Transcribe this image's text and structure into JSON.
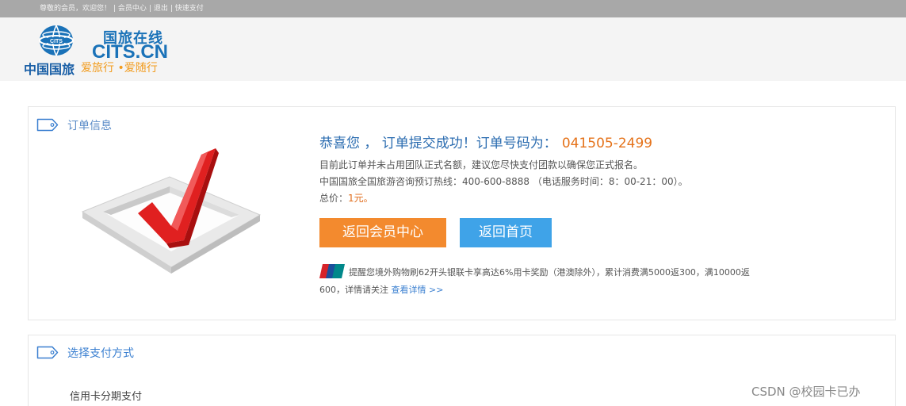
{
  "topbar": {
    "greeting": "尊敬的会员，欢迎您！",
    "links": [
      "会员中心",
      "退出",
      "快速支付"
    ]
  },
  "logo": {
    "brand_cn": "国旅在线",
    "brand_en": "CITS.CN",
    "company": "中国国旅",
    "slogan": "爱旅行 •爱随行"
  },
  "order_panel": {
    "title": "订单信息",
    "success_text": "恭喜您 ， 订单提交成功！订单号码为：",
    "order_number": "041505-2499",
    "line_1": "目前此订单并未占用团队正式名额，建议您尽快支付团款以确保您正式报名。",
    "line_2": "中国国旅全国旅游咨询预订热线：400-600-8888 （电话服务时间：8：00-21：00）。",
    "price_label": "总价：",
    "price_value": "1元。",
    "btn_member": "返回会员中心",
    "btn_home": "返回首页",
    "promo_line_1": "提醒您境外购物刷62开头银联卡享高达6%用卡奖励（港澳除外），累计消费满5000返300，满10000返",
    "promo_line_2": "600，详情请关注 ",
    "promo_link": "查看详情 >>"
  },
  "payment_panel": {
    "title": "选择支付方式",
    "option_1": "信用卡分期支付"
  },
  "watermark": "CSDN @校园卡已办",
  "colors": {
    "orange": "#f38a2e",
    "blue": "#3fa3e8",
    "order_number": "#e5731b",
    "topbar": "#a8a8a8"
  }
}
